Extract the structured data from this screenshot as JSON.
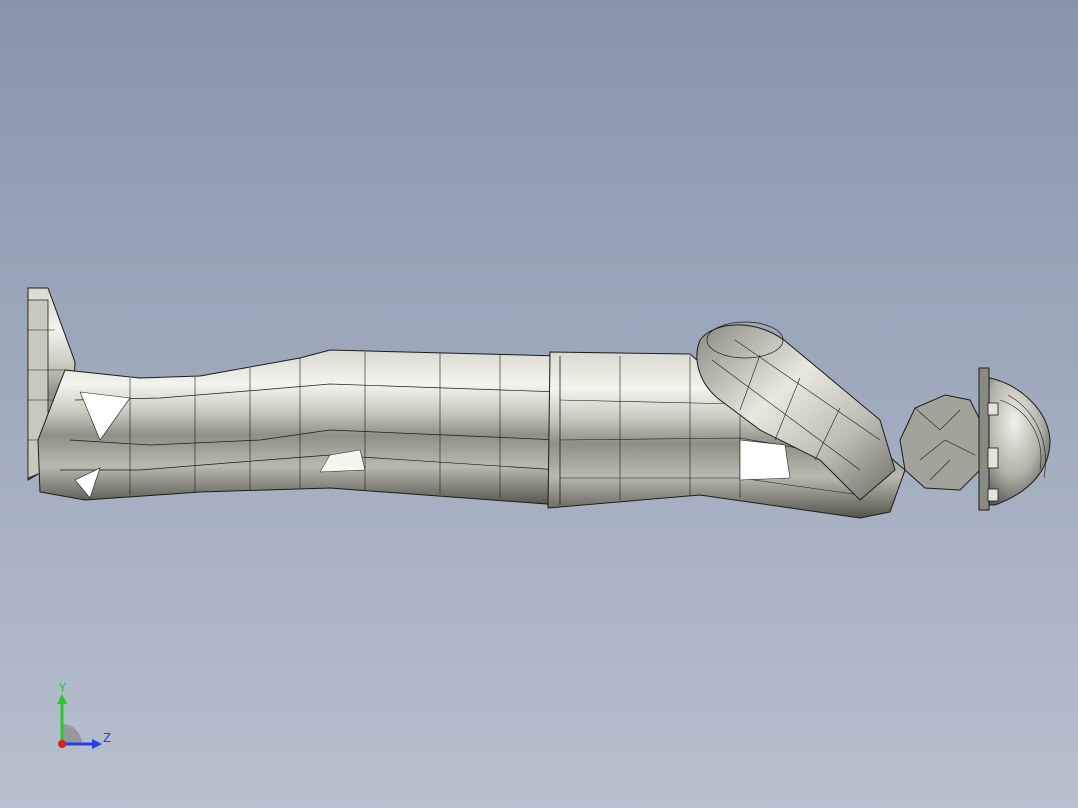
{
  "viewport": {
    "background_top": "#8796ab",
    "background_bottom": "#b8c0cf"
  },
  "model": {
    "icon": "mesh-figure-icon",
    "fill_light": "#f4f4ee",
    "fill_mid": "#b9b9b0",
    "fill_dark": "#55554e",
    "edge_color": "#1c1c1a"
  },
  "triad": {
    "x_color": "#e02020",
    "y_color": "#22cc22",
    "z_color": "#2a3dea",
    "y_label": "Y",
    "z_label": "Z"
  }
}
